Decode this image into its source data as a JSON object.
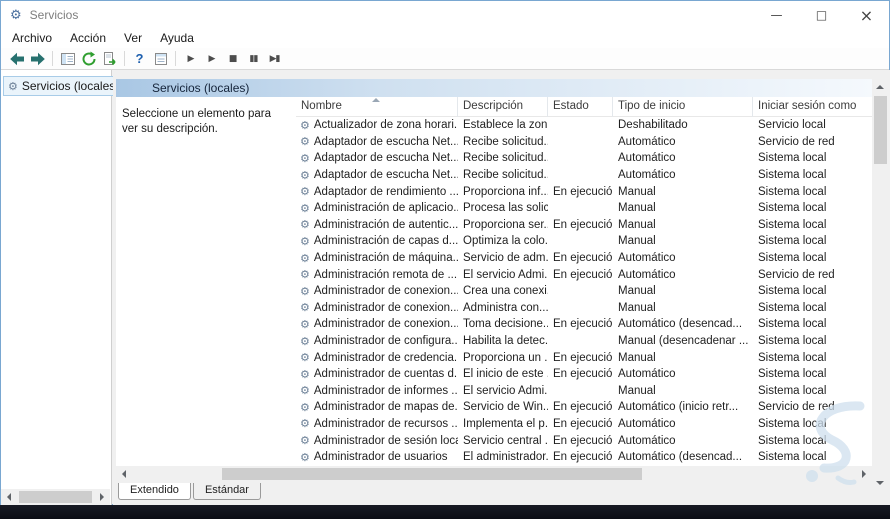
{
  "window": {
    "title": "Servicios",
    "controls": {
      "minimize": "—",
      "maximize": "□",
      "close": "×"
    }
  },
  "icons": {
    "gear": "⚙",
    "help_glyph": "?",
    "toolbar_icon_names": [
      "back-icon",
      "forward-icon",
      "show-console-tree-icon",
      "refresh-icon",
      "export-list-icon",
      "help-icon",
      "properties-icon"
    ]
  },
  "menu": {
    "items": [
      "Archivo",
      "Acción",
      "Ver",
      "Ayuda"
    ]
  },
  "toolbar": {
    "media_buttons": [
      {
        "name": "start-service",
        "glyph": "▶"
      },
      {
        "name": "resume-service",
        "glyph": "▶"
      },
      {
        "name": "stop-service",
        "glyph": "■"
      },
      {
        "name": "pause-service",
        "glyph": "▮▮"
      },
      {
        "name": "restart-service",
        "glyph": "▶▮"
      }
    ]
  },
  "tree": {
    "root_label": "Servicios (locales)"
  },
  "panel": {
    "header": "Servicios (locales)",
    "description": "Seleccione un elemento para ver su descripción."
  },
  "table": {
    "columns": [
      "Nombre",
      "Descripción",
      "Estado",
      "Tipo de inicio",
      "Iniciar sesión como"
    ],
    "sort_column": "Nombre",
    "rows": [
      {
        "name": "Actualizador de zona horari...",
        "desc": "Establece la zon...",
        "estado": "",
        "inicio": "Deshabilitado",
        "sesion": "Servicio local"
      },
      {
        "name": "Adaptador de escucha Net...",
        "desc": "Recibe solicitud...",
        "estado": "",
        "inicio": "Automático",
        "sesion": "Servicio de red"
      },
      {
        "name": "Adaptador de escucha Net...",
        "desc": "Recibe solicitud...",
        "estado": "",
        "inicio": "Automático",
        "sesion": "Sistema local"
      },
      {
        "name": "Adaptador de escucha Net...",
        "desc": "Recibe solicitud...",
        "estado": "",
        "inicio": "Automático",
        "sesion": "Sistema local"
      },
      {
        "name": "Adaptador de rendimiento ...",
        "desc": "Proporciona inf...",
        "estado": "En ejecución",
        "inicio": "Manual",
        "sesion": "Sistema local"
      },
      {
        "name": "Administración de aplicacio...",
        "desc": "Procesa las solic...",
        "estado": "",
        "inicio": "Manual",
        "sesion": "Sistema local"
      },
      {
        "name": "Administración de autentic...",
        "desc": "Proporciona ser...",
        "estado": "En ejecución",
        "inicio": "Manual",
        "sesion": "Sistema local"
      },
      {
        "name": "Administración de capas d...",
        "desc": "Optimiza la colo...",
        "estado": "",
        "inicio": "Manual",
        "sesion": "Sistema local"
      },
      {
        "name": "Administración de máquina...",
        "desc": "Servicio de adm...",
        "estado": "En ejecución",
        "inicio": "Automático",
        "sesion": "Sistema local"
      },
      {
        "name": "Administración remota de ...",
        "desc": "El servicio Admi...",
        "estado": "En ejecución",
        "inicio": "Automático",
        "sesion": "Servicio de red"
      },
      {
        "name": "Administrador de conexion...",
        "desc": "Crea una conexi...",
        "estado": "",
        "inicio": "Manual",
        "sesion": "Sistema local"
      },
      {
        "name": "Administrador de conexion...",
        "desc": "Administra con...",
        "estado": "",
        "inicio": "Manual",
        "sesion": "Sistema local"
      },
      {
        "name": "Administrador de conexion...",
        "desc": "Toma decisione...",
        "estado": "En ejecución",
        "inicio": "Automático (desencad...",
        "sesion": "Sistema local"
      },
      {
        "name": "Administrador de configura...",
        "desc": "Habilita la detec...",
        "estado": "",
        "inicio": "Manual (desencadenar ...",
        "sesion": "Sistema local"
      },
      {
        "name": "Administrador de credencia...",
        "desc": "Proporciona un ...",
        "estado": "En ejecución",
        "inicio": "Manual",
        "sesion": "Sistema local"
      },
      {
        "name": "Administrador de cuentas d...",
        "desc": "El inicio de este ...",
        "estado": "En ejecución",
        "inicio": "Automático",
        "sesion": "Sistema local"
      },
      {
        "name": "Administrador de informes ...",
        "desc": "El servicio Admi...",
        "estado": "",
        "inicio": "Manual",
        "sesion": "Sistema local"
      },
      {
        "name": "Administrador de mapas de...",
        "desc": "Servicio de Win...",
        "estado": "En ejecución",
        "inicio": "Automático (inicio retr...",
        "sesion": "Servicio de red"
      },
      {
        "name": "Administrador de recursos ...",
        "desc": "Implementa el p...",
        "estado": "En ejecución",
        "inicio": "Automático",
        "sesion": "Sistema local"
      },
      {
        "name": "Administrador de sesión local",
        "desc": "Servicio central ...",
        "estado": "En ejecución",
        "inicio": "Automático",
        "sesion": "Sistema local"
      },
      {
        "name": "Administrador de usuarios",
        "desc": "El administrador...",
        "estado": "En ejecución",
        "inicio": "Automático (desencad...",
        "sesion": "Sistema local"
      }
    ]
  },
  "tabs": {
    "items": [
      "Extendido",
      "Estándar"
    ],
    "selected": "Extendido"
  },
  "colors": {
    "window_border": "#79a7d1",
    "header_gradient_left": "#a9c7e4",
    "header_gradient_right": "#f5f9fd",
    "nav_arrow_teal": "#27716f",
    "refresh_green": "#2f9e2f",
    "help_blue": "#1d5fae"
  }
}
